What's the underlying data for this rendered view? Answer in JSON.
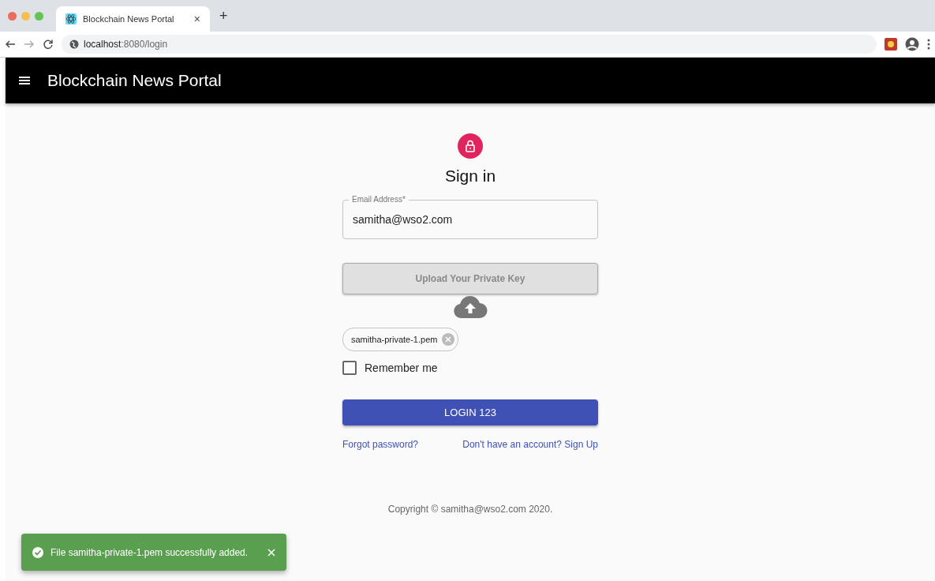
{
  "browser": {
    "tabs": [
      {
        "title": "Blockchain News Portal",
        "close": "×",
        "selected": true
      }
    ],
    "new_tab": "+",
    "url_host": "localhost",
    "url_path": ":8080/login"
  },
  "app_bar": {
    "title": "Blockchain News Portal"
  },
  "form": {
    "heading": "Sign in",
    "email": {
      "label": "Email Address",
      "required_mark": "*",
      "value": "samitha@wso2.com"
    },
    "upload": {
      "label": "Upload Your Private Key",
      "disabled": true
    },
    "file_chip": {
      "label": "samitha-private-1.pem"
    },
    "remember": {
      "label": "Remember me",
      "checked": false
    },
    "submit": "LOGIN 123",
    "links": [
      "Forgot password?",
      "Don't have an account? Sign Up"
    ]
  },
  "copyright": "Copyright © samitha@wso2.com 2020.",
  "snackbar": {
    "message": "File samitha-private-1.pem successfully added.",
    "kind": "success"
  }
}
